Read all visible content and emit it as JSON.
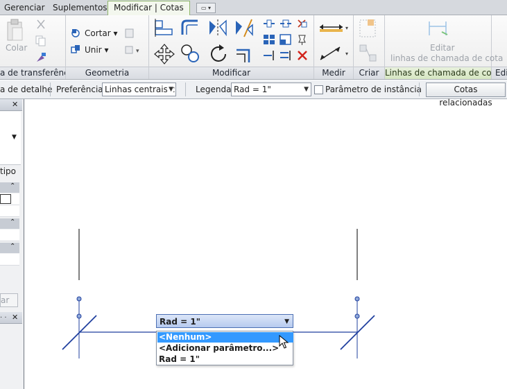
{
  "tabs": [
    {
      "label": "Gerenciar",
      "active": false
    },
    {
      "label": "Suplementos",
      "active": false
    },
    {
      "label": "Modificar | Cotas",
      "active": true
    }
  ],
  "ribbon": {
    "clipboard": {
      "title": "a de transferência",
      "paste_label": "Colar"
    },
    "geometry": {
      "title": "Geometria",
      "cut_label": "Cortar",
      "join_label": "Unir"
    },
    "modify": {
      "title": "Modificar"
    },
    "measure": {
      "title": "Medir"
    },
    "create": {
      "title": "Criar"
    },
    "leaders": {
      "title": "Linhas de chamada de cota",
      "edit_line1": "Editar",
      "edit_line2": "linhas de chamada de cota"
    },
    "edit_partial": {
      "title": "Edi"
    }
  },
  "options_bar": {
    "detail_label": "a de detalhe",
    "preference_label": "Preferência:",
    "preference_value": "Linhas centrais c",
    "legend_label": "Legenda:",
    "legend_value": "Rad = 1\"",
    "instance_param_label": "Parâmetro de instância",
    "related_dims_button": "Cotas relacionadas"
  },
  "palette": {
    "type_label": "tipo",
    "apply_label": "ar"
  },
  "label_dropdown": {
    "value": "Rad = 1\"",
    "options": [
      "<Nenhum>",
      "<Adicionar parâmetro...>",
      "Rad = 1\""
    ],
    "selected_index": 0
  },
  "colors": {
    "accent_tab": "#8fb66a",
    "dimension_line": "#1f3f9e",
    "selection": "#3399ff",
    "ribbon_icon_blue": "#2a64b8"
  }
}
